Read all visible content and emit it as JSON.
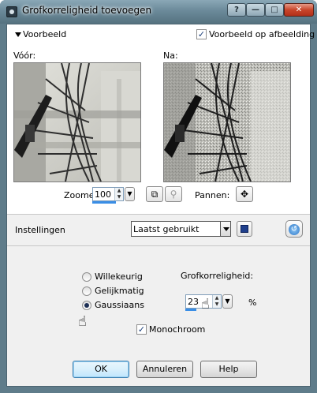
{
  "window": {
    "title": "Grofkorreligheid toevoegen",
    "buttons": {
      "help": "?",
      "minimize": "—",
      "maximize": "□",
      "close": "✕"
    }
  },
  "preview": {
    "toggle_label": "Voorbeeld",
    "on_image_label": "Voorbeeld op afbeelding",
    "on_image_checked": true,
    "before_label": "Vóór:",
    "after_label": "Na:",
    "zoom_label": "Zoomen:",
    "zoom_value": "100",
    "pan_label": "Pannen:",
    "pan_icon": "✥"
  },
  "settings": {
    "label": "Instellingen",
    "preset_value": "Laatst gebruikt"
  },
  "options": {
    "radios": [
      {
        "label": "Willekeurig",
        "selected": false
      },
      {
        "label": "Gelijkmatig",
        "selected": false
      },
      {
        "label": "Gaussiaans",
        "selected": true
      }
    ],
    "grain_label": "Grofkorreligheid:",
    "grain_value": "23",
    "grain_unit": "%",
    "monochrome_label": "Monochroom",
    "monochrome_checked": true
  },
  "footer": {
    "ok": "OK",
    "cancel": "Annuleren",
    "help": "Help"
  }
}
